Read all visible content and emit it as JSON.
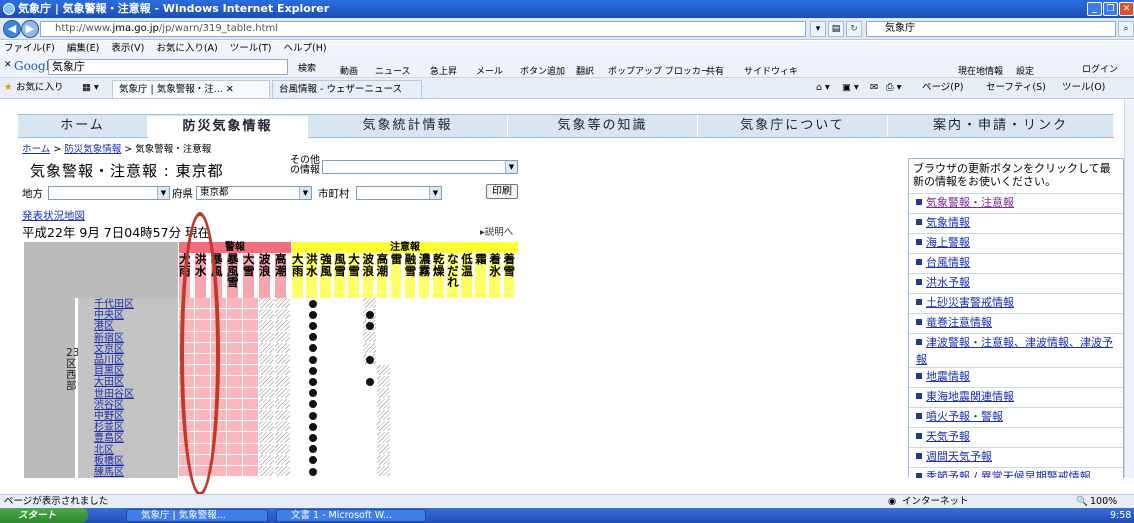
{
  "window": {
    "title": "気象庁 | 気象警報・注意報 - Windows Internet Explorer",
    "address_prefix": "http://www.",
    "address_domain": "jma.go.jp",
    "address_suffix": "/jp/warn/319_table.html",
    "search_text": "気象庁"
  },
  "menubar": [
    "ファイル(F)",
    "編集(E)",
    "表示(V)",
    "お気に入り(A)",
    "ツール(T)",
    "ヘルプ(H)"
  ],
  "google_toolbar": {
    "brand": "Google",
    "query": "気象庁",
    "buttons": [
      "検索",
      "動画",
      "ニュース",
      "急上昇",
      "メール",
      "ボタン追加",
      "翻訳",
      "ポップアップ ブロッカー",
      "共有",
      "サイドウィキ"
    ],
    "right_buttons": [
      "現在地情報",
      "設定",
      "ログイン"
    ]
  },
  "favbar": {
    "favorites": "お気に入り",
    "tabs": [
      "気象庁 | 気象警報・注...",
      "台風情報 - ウェザーニュース"
    ],
    "right_tools": [
      "ページ(P)",
      "セーフティ(S)",
      "ツール(O)"
    ]
  },
  "nav": [
    "ホーム",
    "防災気象情報",
    "気象統計情報",
    "気象等の知識",
    "気象庁について",
    "案内・申請・リンク"
  ],
  "breadcrumb": {
    "home": "ホーム",
    "parent": "防災気象情報",
    "current": "気象警報・注意報"
  },
  "page_title_label": "気象警報・注意報",
  "page_title_place": "東京都",
  "sonota_label": "その他の情報",
  "filters": {
    "chiho_label": "地方",
    "fuken_label": "府県",
    "fuken_value": "東京都",
    "shichoson_label": "市町村"
  },
  "print_label": "印刷",
  "status_map_link": "発表状況地図",
  "datetime": "平成22年 9月 7日04時57分 現在",
  "explain_link": "説明へ",
  "table": {
    "warn_header": "警報",
    "advisory_header": "注意報",
    "warn_cols": [
      "大雨",
      "洪水",
      "暴風",
      "暴風雪",
      "大雪",
      "波浪",
      "高潮"
    ],
    "adv_cols": [
      "大雨",
      "洪水",
      "強風",
      "風雪",
      "大雪",
      "波浪",
      "高潮",
      "雷",
      "融雪",
      "濃霧",
      "乾燥",
      "なだれ",
      "低温",
      "霜",
      "着氷",
      "着雪"
    ],
    "region_label": "23区西部",
    "wards": [
      "千代田区",
      "中央区",
      "港区",
      "新宿区",
      "文京区",
      "品川区",
      "目黒区",
      "大田区",
      "世田谷区",
      "渋谷区",
      "中野区",
      "杉並区",
      "豊島区",
      "北区",
      "板橋区",
      "練馬区"
    ]
  },
  "right_panel": {
    "message": "ブラウザの更新ボタンをクリックして最新の情報をお使いください。",
    "links": [
      "気象警報・注意報",
      "気象情報",
      "海上警報",
      "台風情報",
      "洪水予報",
      "土砂災害警戒情報",
      "竜巻注意情報",
      "津波警報・注意報、津波情報、津波予報",
      "地震情報",
      "東海地震関連情報",
      "噴火予報・警報",
      "天気予報",
      "週間天気予報",
      "季節予報 / 異常天候早期警戒情報"
    ]
  },
  "statusbar": {
    "text": "ページが表示されました",
    "zone": "インターネット",
    "zoom": "100%"
  },
  "taskbar": {
    "start": "スタート",
    "tasks": [
      "気象庁 | 気象警報...",
      "文書 1 - Microsoft W..."
    ],
    "clock": "9:58"
  }
}
